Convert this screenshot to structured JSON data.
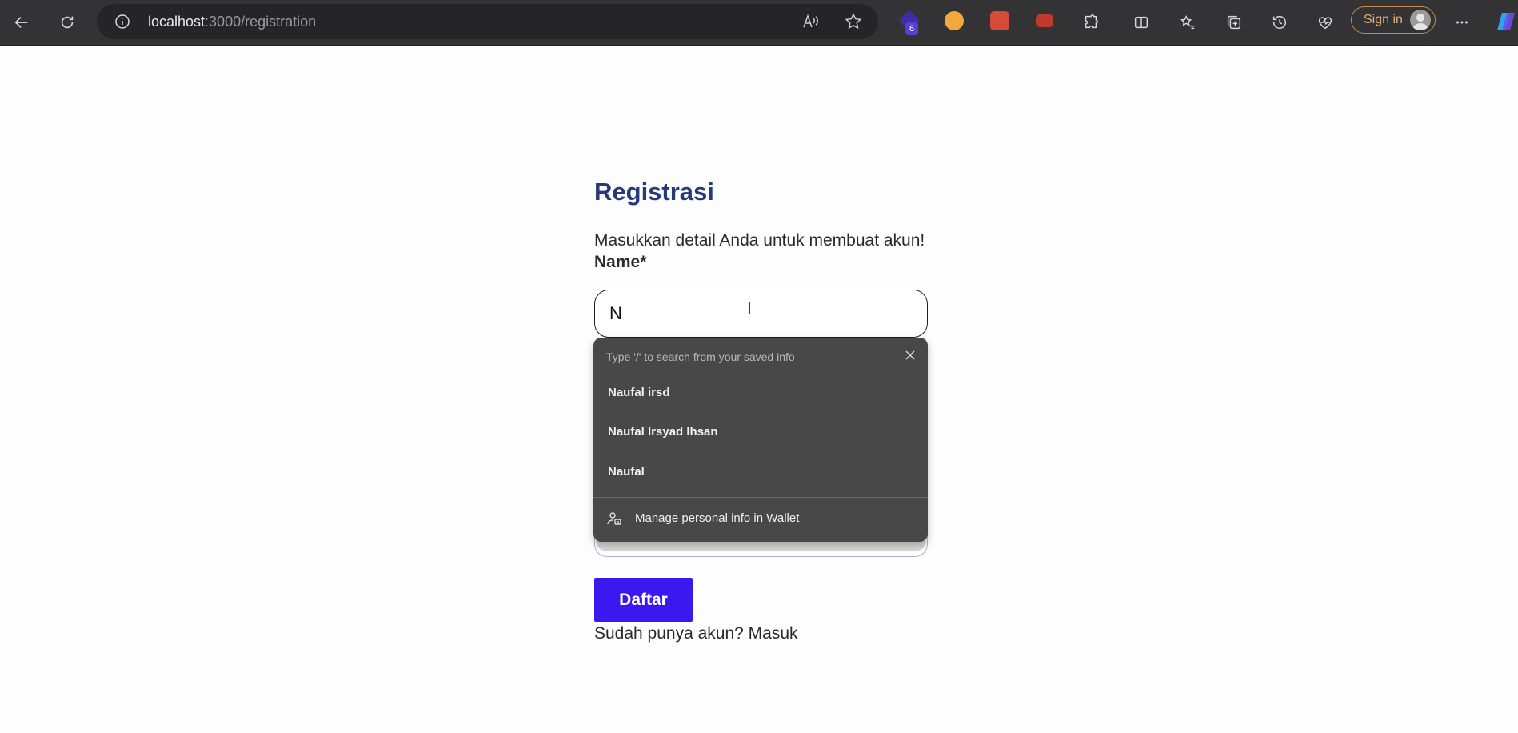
{
  "browser": {
    "url_host": "localhost",
    "url_path": ":3000/registration",
    "extension_badge": "6",
    "sign_in_label": "Sign in",
    "accent_color": "#c98a4a"
  },
  "page": {
    "title": "Registrasi",
    "subtitle": "Masukkan detail Anda untuk membuat akun!",
    "name_label": "Name*",
    "name_value": "N",
    "submit_label": "Daftar",
    "login_prompt": "Sudah punya akun? Masuk",
    "title_color": "#273a78",
    "button_color": "#3b17f0"
  },
  "autofill": {
    "hint": "Type '/' to search from your saved info",
    "suggestions": [
      "Naufal irsd",
      "Naufal Irsyad Ihsan",
      "Naufal"
    ],
    "manage_label": "Manage personal info in Wallet"
  }
}
